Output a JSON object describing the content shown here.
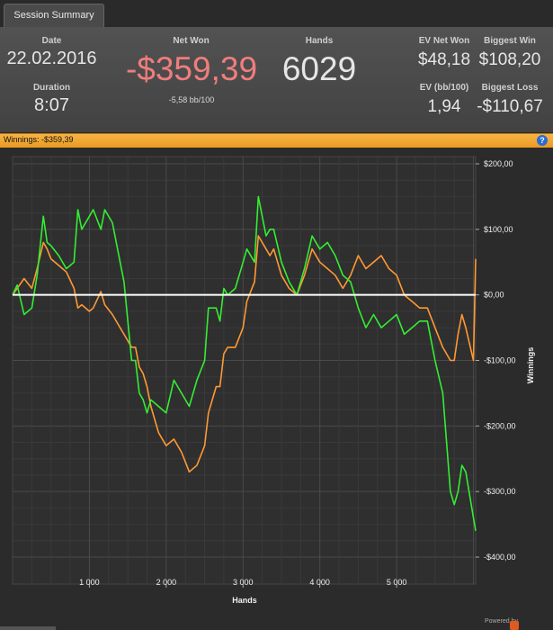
{
  "tab": {
    "label": "Session Summary"
  },
  "summary": {
    "date_label": "Date",
    "date_value": "22.02.2016",
    "duration_label": "Duration",
    "duration_value": "8:07",
    "netwon_label": "Net Won",
    "netwon_value": "-$359,39",
    "netwon_sub": "-5,58 bb/100",
    "hands_label": "Hands",
    "hands_value": "6029",
    "ev_net_label": "EV Net Won",
    "ev_net_value": "$48,18",
    "ev_bb_label": "EV (bb/100)",
    "ev_bb_value": "1,94",
    "big_win_label": "Biggest Win",
    "big_win_value": "$108,20",
    "big_loss_label": "Biggest Loss",
    "big_loss_value": "-$110,67"
  },
  "winnings_bar": {
    "text": "Winnings:  -$359,39",
    "help": "?"
  },
  "footer": {
    "powered": "Powered by"
  },
  "colors": {
    "green": "#33ee33",
    "orange": "#ff9933",
    "negative": "#f07d7d",
    "accent": "#f5a42f"
  },
  "chart_data": {
    "type": "line",
    "xlabel": "Hands",
    "ylabel": "Winnings",
    "xlim": [
      0,
      6029
    ],
    "ylim": [
      -400,
      200
    ],
    "yticks": [
      200,
      100,
      0,
      -100,
      -200,
      -300,
      -400
    ],
    "ytick_labels": [
      "$200,00",
      "$100,00",
      "$0,00",
      "-$100,00",
      "-$200,00",
      "-$300,00",
      "-$400,00"
    ],
    "xticks": [
      1000,
      2000,
      3000,
      4000,
      5000
    ],
    "xtick_labels": [
      "1 000",
      "2 000",
      "3 000",
      "4 000",
      "5 000"
    ],
    "grid": true,
    "series": [
      {
        "style": "green",
        "x": [
          0,
          60,
          150,
          250,
          320,
          400,
          450,
          500,
          600,
          700,
          800,
          850,
          900,
          1000,
          1050,
          1150,
          1200,
          1300,
          1400,
          1450,
          1550,
          1600,
          1650,
          1700,
          1750,
          1800,
          1900,
          2000,
          2100,
          2200,
          2300,
          2400,
          2500,
          2550,
          2650,
          2700,
          2750,
          2800,
          2900,
          3000,
          3050,
          3150,
          3200,
          3300,
          3350,
          3400,
          3500,
          3600,
          3700,
          3800,
          3900,
          4000,
          4100,
          4200,
          4300,
          4400,
          4500,
          4600,
          4700,
          4800,
          4900,
          5000,
          5100,
          5200,
          5300,
          5400,
          5500,
          5600,
          5700,
          5750,
          5800,
          5850,
          5900,
          6000,
          6029
        ],
        "y": [
          0,
          15,
          -30,
          -20,
          30,
          120,
          80,
          75,
          60,
          40,
          50,
          130,
          100,
          120,
          130,
          100,
          130,
          110,
          50,
          20,
          -100,
          -100,
          -150,
          -160,
          -180,
          -160,
          -170,
          -180,
          -130,
          -150,
          -170,
          -130,
          -100,
          -20,
          -20,
          -40,
          10,
          0,
          10,
          50,
          70,
          50,
          150,
          90,
          100,
          100,
          50,
          20,
          0,
          40,
          90,
          70,
          80,
          60,
          30,
          20,
          -20,
          -50,
          -30,
          -50,
          -40,
          -30,
          -60,
          -50,
          -40,
          -40,
          -100,
          -150,
          -300,
          -320,
          -300,
          -260,
          -270,
          -340,
          -360
        ]
      },
      {
        "style": "orange",
        "x": [
          0,
          60,
          150,
          250,
          320,
          400,
          450,
          500,
          600,
          700,
          800,
          850,
          900,
          1000,
          1050,
          1150,
          1200,
          1300,
          1400,
          1450,
          1550,
          1600,
          1650,
          1700,
          1750,
          1800,
          1900,
          2000,
          2100,
          2200,
          2300,
          2400,
          2500,
          2550,
          2650,
          2700,
          2750,
          2800,
          2900,
          3000,
          3050,
          3150,
          3200,
          3300,
          3350,
          3400,
          3500,
          3600,
          3700,
          3800,
          3900,
          4000,
          4100,
          4200,
          4300,
          4400,
          4500,
          4600,
          4700,
          4800,
          4900,
          5000,
          5100,
          5200,
          5300,
          5400,
          5500,
          5600,
          5700,
          5750,
          5800,
          5850,
          5900,
          6000,
          6029
        ],
        "y": [
          0,
          10,
          25,
          10,
          40,
          80,
          70,
          55,
          45,
          35,
          10,
          -20,
          -15,
          -25,
          -20,
          5,
          -15,
          -30,
          -50,
          -60,
          -80,
          -80,
          -110,
          -120,
          -140,
          -170,
          -210,
          -230,
          -220,
          -240,
          -270,
          -260,
          -230,
          -180,
          -140,
          -140,
          -90,
          -80,
          -80,
          -50,
          -10,
          20,
          90,
          70,
          60,
          70,
          30,
          10,
          0,
          30,
          70,
          50,
          40,
          30,
          10,
          30,
          60,
          40,
          50,
          60,
          40,
          30,
          0,
          -10,
          -20,
          -20,
          -50,
          -80,
          -100,
          -100,
          -60,
          -30,
          -50,
          -100,
          55
        ]
      }
    ]
  }
}
